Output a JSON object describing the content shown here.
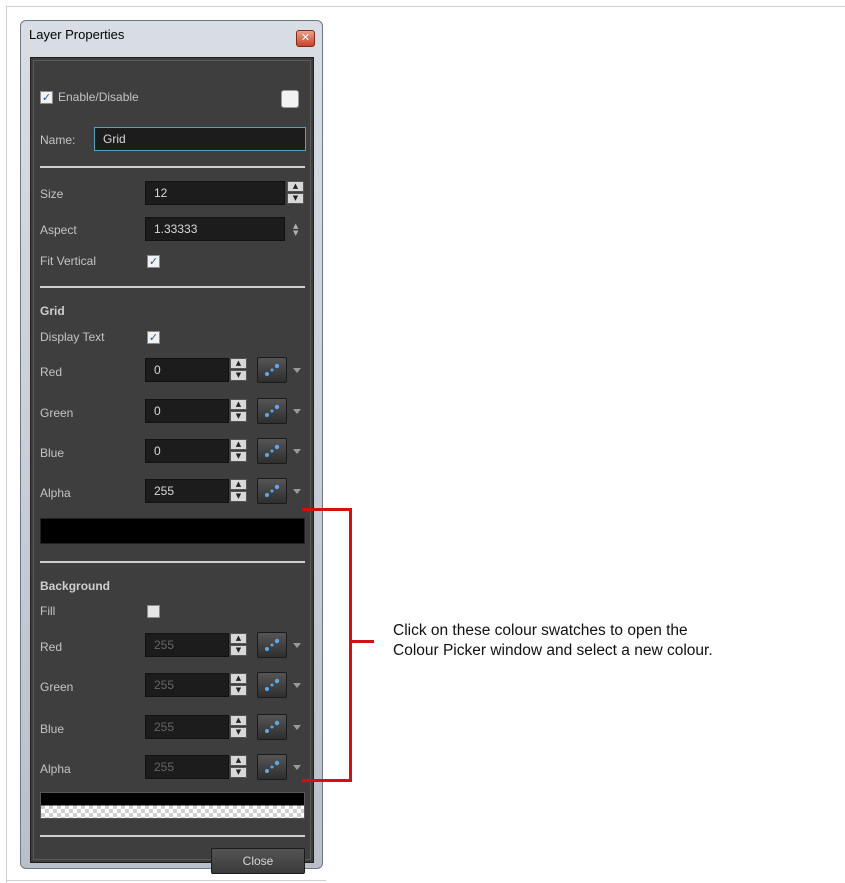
{
  "window": {
    "title": "Layer Properties",
    "close_glyph": "✕"
  },
  "general": {
    "enable_label": "Enable/Disable",
    "enable_checked": true,
    "name_label": "Name:",
    "name_value": "Grid"
  },
  "layout": {
    "size_label": "Size",
    "size_value": "12",
    "aspect_label": "Aspect",
    "aspect_value": "1.33333",
    "fit_vertical_label": "Fit Vertical",
    "fit_vertical_checked": true
  },
  "grid": {
    "heading": "Grid",
    "display_text_label": "Display Text",
    "display_text_checked": true,
    "channels": [
      {
        "label": "Red",
        "value": "0"
      },
      {
        "label": "Green",
        "value": "0"
      },
      {
        "label": "Blue",
        "value": "0"
      },
      {
        "label": "Alpha",
        "value": "255"
      }
    ],
    "swatch_color": "#000000"
  },
  "background": {
    "heading": "Background",
    "fill_label": "Fill",
    "fill_checked": false,
    "channels": [
      {
        "label": "Red",
        "value": "255"
      },
      {
        "label": "Green",
        "value": "255"
      },
      {
        "label": "Blue",
        "value": "255"
      },
      {
        "label": "Alpha",
        "value": "255"
      }
    ]
  },
  "buttons": {
    "close_label": "Close"
  },
  "icons": {
    "checkmark": "✓",
    "spin_up": "▲",
    "spin_down": "▼",
    "picker": "eyedropper-icon"
  },
  "annotation": {
    "line1": "Click on these colour swatches to open the",
    "line2": "Colour Picker window and select a new colour.",
    "color": "#d40f0f"
  }
}
